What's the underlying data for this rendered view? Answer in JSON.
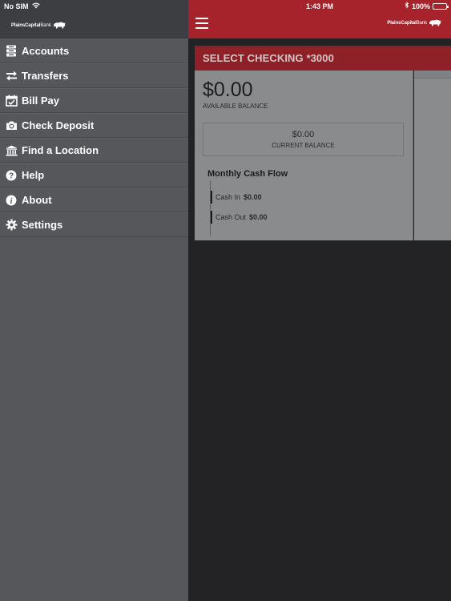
{
  "status_bar": {
    "carrier": "No SIM",
    "time": "1:43 PM",
    "battery_percent": "100%",
    "battery_level": 1.0
  },
  "brand": {
    "logo_bold": "PlainsCapital",
    "logo_thin": "Bank",
    "accent_color": "#a6232b"
  },
  "sidebar": {
    "items": [
      {
        "label": "Accounts",
        "icon": "accounts-icon"
      },
      {
        "label": "Transfers",
        "icon": "transfers-icon"
      },
      {
        "label": "Bill Pay",
        "icon": "calendar-check-icon"
      },
      {
        "label": "Check Deposit",
        "icon": "camera-icon"
      },
      {
        "label": "Find a Location",
        "icon": "bank-building-icon"
      },
      {
        "label": "Help",
        "icon": "help-icon"
      },
      {
        "label": "About",
        "icon": "info-icon"
      },
      {
        "label": "Settings",
        "icon": "gear-icon"
      }
    ]
  },
  "account": {
    "title": "SELECT CHECKING *3000",
    "available_balance": "$0.00",
    "available_label": "AVAILABLE BALANCE",
    "current_balance": "$0.00",
    "current_label": "CURRENT BALANCE",
    "cash_flow_title": "Monthly Cash Flow",
    "cash_in_label": "Cash In",
    "cash_in_value": "$0.00",
    "cash_out_label": "Cash Out",
    "cash_out_value": "$0.00"
  }
}
